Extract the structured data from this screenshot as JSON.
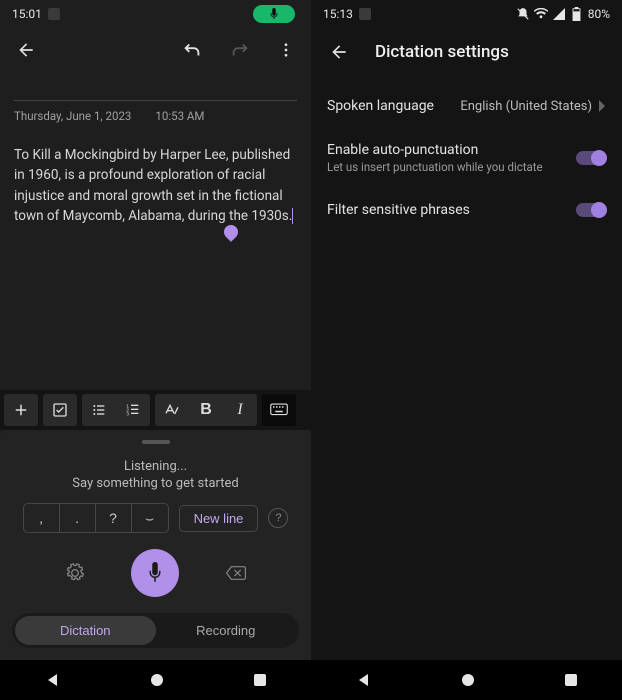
{
  "left": {
    "status": {
      "time": "15:01"
    },
    "note": {
      "date": "Thursday, June 1, 2023",
      "time": "10:53 AM",
      "body": "To Kill a Mockingbird by Harper Lee, published in 1960, is a profound exploration of racial injustice and moral growth set in the fictional town of Maycomb, Alabama, during the 1930s."
    },
    "toolbar": {
      "bold": "B",
      "italic": "I"
    },
    "dictation": {
      "listening": "Listening...",
      "hint": "Say something to get started",
      "comma": ",",
      "period": ".",
      "question": "?",
      "space": "⌣",
      "newline": "New line",
      "help": "?",
      "mode_dictation": "Dictation",
      "mode_recording": "Recording"
    }
  },
  "right": {
    "status": {
      "time": "15:13",
      "battery": "80%"
    },
    "title": "Dictation settings",
    "settings": {
      "language_label": "Spoken language",
      "language_value": "English (United States)",
      "autop_label": "Enable auto-punctuation",
      "autop_desc": "Let us insert punctuation while you dictate",
      "filter_label": "Filter sensitive phrases"
    }
  }
}
